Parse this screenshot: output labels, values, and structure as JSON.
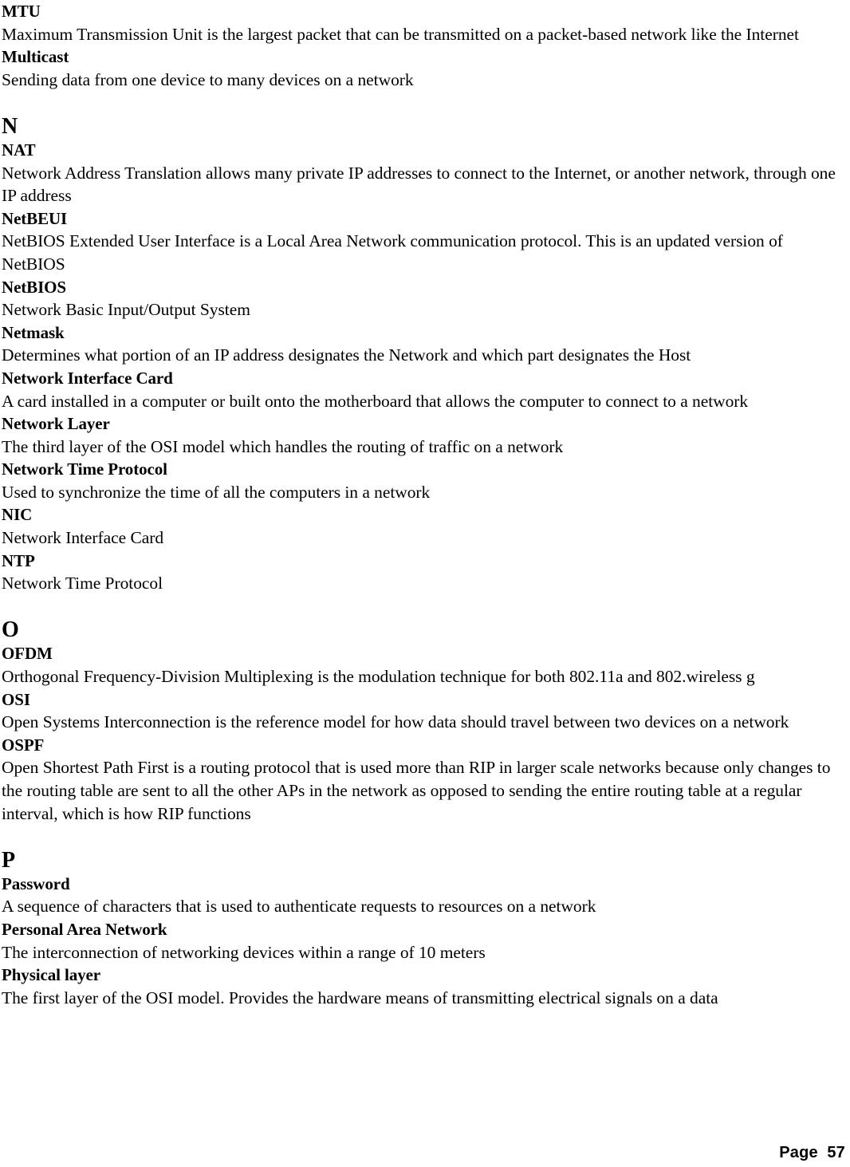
{
  "document": {
    "type": "glossary",
    "page_label": "Page  57",
    "page_number": 57
  },
  "sections": [
    {
      "letter": null,
      "show_letter": false,
      "entries": [
        {
          "term": "MTU",
          "definition": "Maximum Transmission Unit is the largest packet that can be transmitted on a packet-based network like the Internet"
        },
        {
          "term": "Multicast",
          "definition": "Sending data from one device to many devices on a network"
        }
      ]
    },
    {
      "letter": "N",
      "show_letter": true,
      "entries": [
        {
          "term": "NAT",
          "definition": "Network Address Translation allows many private IP addresses to connect to the Internet, or another network, through one IP address"
        },
        {
          "term": "NetBEUI",
          "definition": "NetBIOS Extended User Interface is a Local Area Network communication protocol. This is an updated version of NetBIOS"
        },
        {
          "term": "NetBIOS",
          "definition": "Network Basic Input/Output System"
        },
        {
          "term": "Netmask",
          "definition": "Determines what portion of an IP address designates the Network and which part designates the Host"
        },
        {
          "term": "Network Interface Card",
          "definition": "A card installed in a computer or built onto the motherboard that allows the computer to connect to a network"
        },
        {
          "term": "Network Layer",
          "definition": "The third layer of the OSI model which handles the routing of traffic on a network"
        },
        {
          "term": "Network Time Protocol",
          "definition": "Used to synchronize the time of all the computers in a network"
        },
        {
          "term": "NIC",
          "definition": "Network Interface Card"
        },
        {
          "term": "NTP",
          "definition": "Network Time Protocol"
        }
      ]
    },
    {
      "letter": "O",
      "show_letter": true,
      "entries": [
        {
          "term": "OFDM",
          "definition": "Orthogonal Frequency-Division Multiplexing is the modulation technique for both 802.11a and 802.wireless g"
        },
        {
          "term": "OSI",
          "definition": "Open Systems Interconnection is the reference model for how data should travel between two devices on a network"
        },
        {
          "term": "OSPF",
          "definition": "Open Shortest Path First is a routing protocol that is used more than RIP in larger scale networks because only changes to the routing table are sent to all the other APs in the network as opposed to sending the entire routing table at a regular interval, which is how RIP functions"
        }
      ]
    },
    {
      "letter": "P",
      "show_letter": true,
      "entries": [
        {
          "term": "Password",
          "definition": "A sequence of characters that is used to authenticate requests to resources on a network"
        },
        {
          "term": "Personal Area Network",
          "definition": "The interconnection of networking devices within a range of 10 meters"
        },
        {
          "term": "Physical layer",
          "definition": "The first layer of the OSI model. Provides the hardware means of transmitting electrical signals on a data"
        }
      ]
    }
  ]
}
